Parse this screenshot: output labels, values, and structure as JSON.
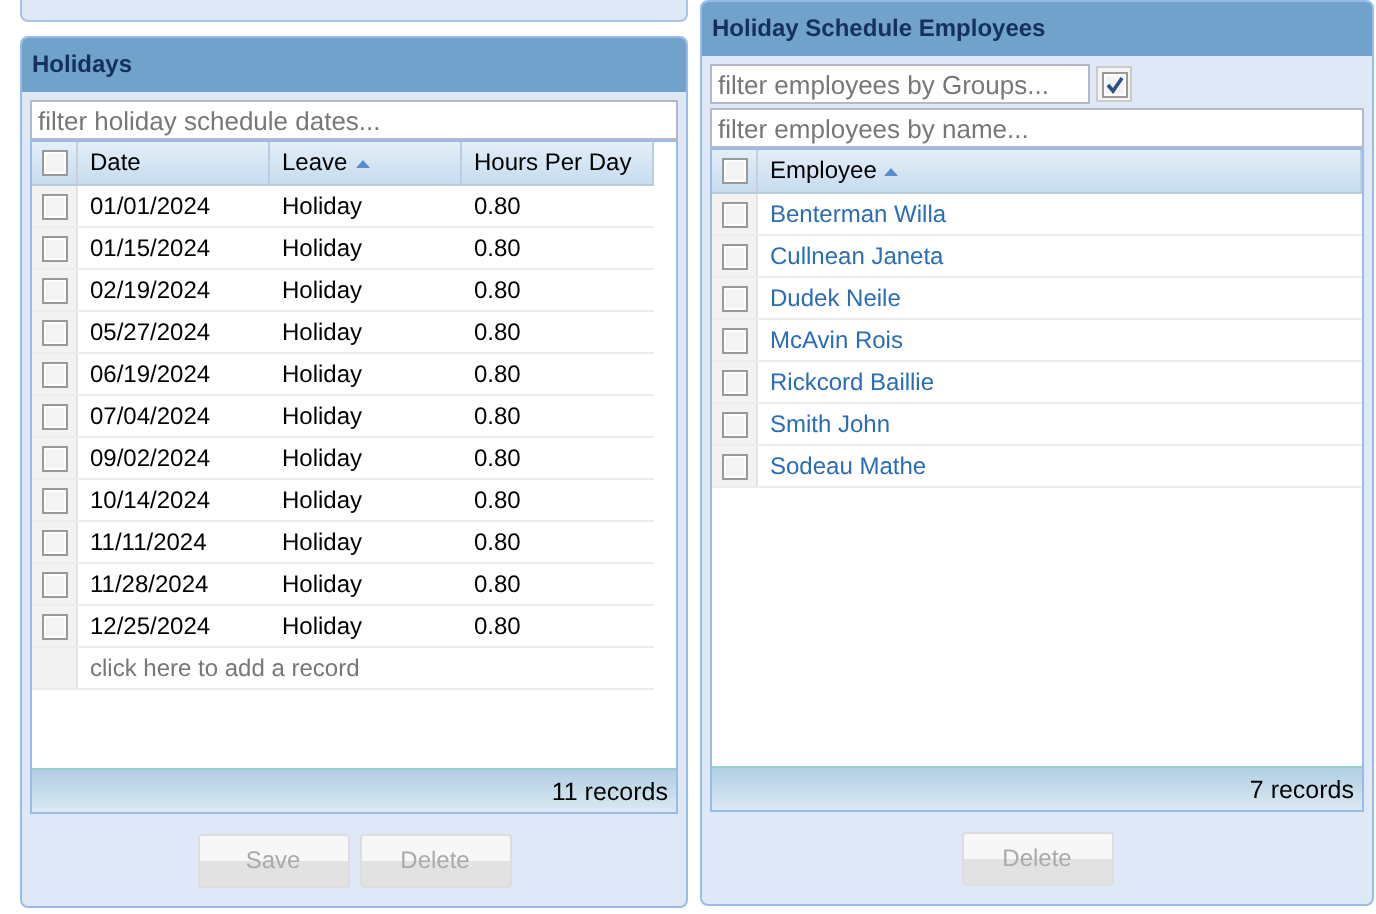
{
  "holidays": {
    "title": "Holidays",
    "filter": {
      "placeholder": "filter holiday schedule dates..."
    },
    "columns": [
      {
        "label": "Date",
        "sorted": false
      },
      {
        "label": "Leave",
        "sorted": true
      },
      {
        "label": "Hours Per Day",
        "sorted": false
      }
    ],
    "select_all": {
      "checked": false
    },
    "rows": [
      {
        "checked": false,
        "cells": [
          "01/01/2024",
          "Holiday",
          "0.80"
        ]
      },
      {
        "checked": false,
        "cells": [
          "01/15/2024",
          "Holiday",
          "0.80"
        ]
      },
      {
        "checked": false,
        "cells": [
          "02/19/2024",
          "Holiday",
          "0.80"
        ]
      },
      {
        "checked": false,
        "cells": [
          "05/27/2024",
          "Holiday",
          "0.80"
        ]
      },
      {
        "checked": false,
        "cells": [
          "06/19/2024",
          "Holiday",
          "0.80"
        ]
      },
      {
        "checked": false,
        "cells": [
          "07/04/2024",
          "Holiday",
          "0.80"
        ]
      },
      {
        "checked": false,
        "cells": [
          "09/02/2024",
          "Holiday",
          "0.80"
        ]
      },
      {
        "checked": false,
        "cells": [
          "10/14/2024",
          "Holiday",
          "0.80"
        ]
      },
      {
        "checked": false,
        "cells": [
          "11/11/2024",
          "Holiday",
          "0.80"
        ]
      },
      {
        "checked": false,
        "cells": [
          "11/28/2024",
          "Holiday",
          "0.80"
        ]
      },
      {
        "checked": false,
        "cells": [
          "12/25/2024",
          "Holiday",
          "0.80"
        ]
      }
    ],
    "add_record": "click here to add a record",
    "footer": "11 records",
    "buttons": [
      {
        "label": "Save",
        "disabled": true
      },
      {
        "label": "Delete",
        "disabled": true
      }
    ]
  },
  "employees": {
    "title": "Holiday Schedule Employees",
    "group_filter": {
      "placeholder": "filter employees by Groups...",
      "checked": true
    },
    "name_filter": {
      "placeholder": "filter employees by name..."
    },
    "columns": [
      {
        "label": "Employee",
        "sorted": true
      }
    ],
    "select_all": {
      "checked": false
    },
    "rows": [
      {
        "checked": false,
        "name": "Benterman Willa"
      },
      {
        "checked": false,
        "name": "Cullnean Janeta"
      },
      {
        "checked": false,
        "name": "Dudek Neile"
      },
      {
        "checked": false,
        "name": "McAvin Rois"
      },
      {
        "checked": false,
        "name": "Rickcord Baillie"
      },
      {
        "checked": false,
        "name": "Smith John"
      },
      {
        "checked": false,
        "name": "Sodeau Mathe"
      }
    ],
    "footer": "7 records",
    "buttons": [
      {
        "label": "Delete",
        "disabled": true
      }
    ]
  }
}
